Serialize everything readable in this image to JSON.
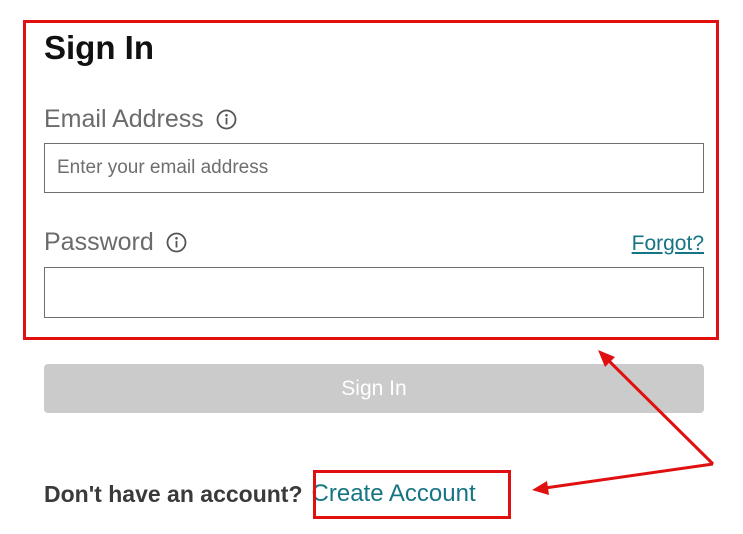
{
  "form": {
    "title": "Sign In",
    "email": {
      "label": "Email Address",
      "placeholder": "Enter your email address",
      "value": ""
    },
    "password": {
      "label": "Password",
      "value": ""
    },
    "forgot_label": "Forgot?",
    "submit_label": "Sign In"
  },
  "footer": {
    "prompt": "Don't have an account?",
    "create_account_label": "Create Account"
  },
  "icons": {
    "info": "info-circle-icon"
  },
  "colors": {
    "link": "#157584",
    "button_disabled": "#cbcbcb",
    "annotation": "#e01010",
    "label": "#6b6b6b"
  }
}
